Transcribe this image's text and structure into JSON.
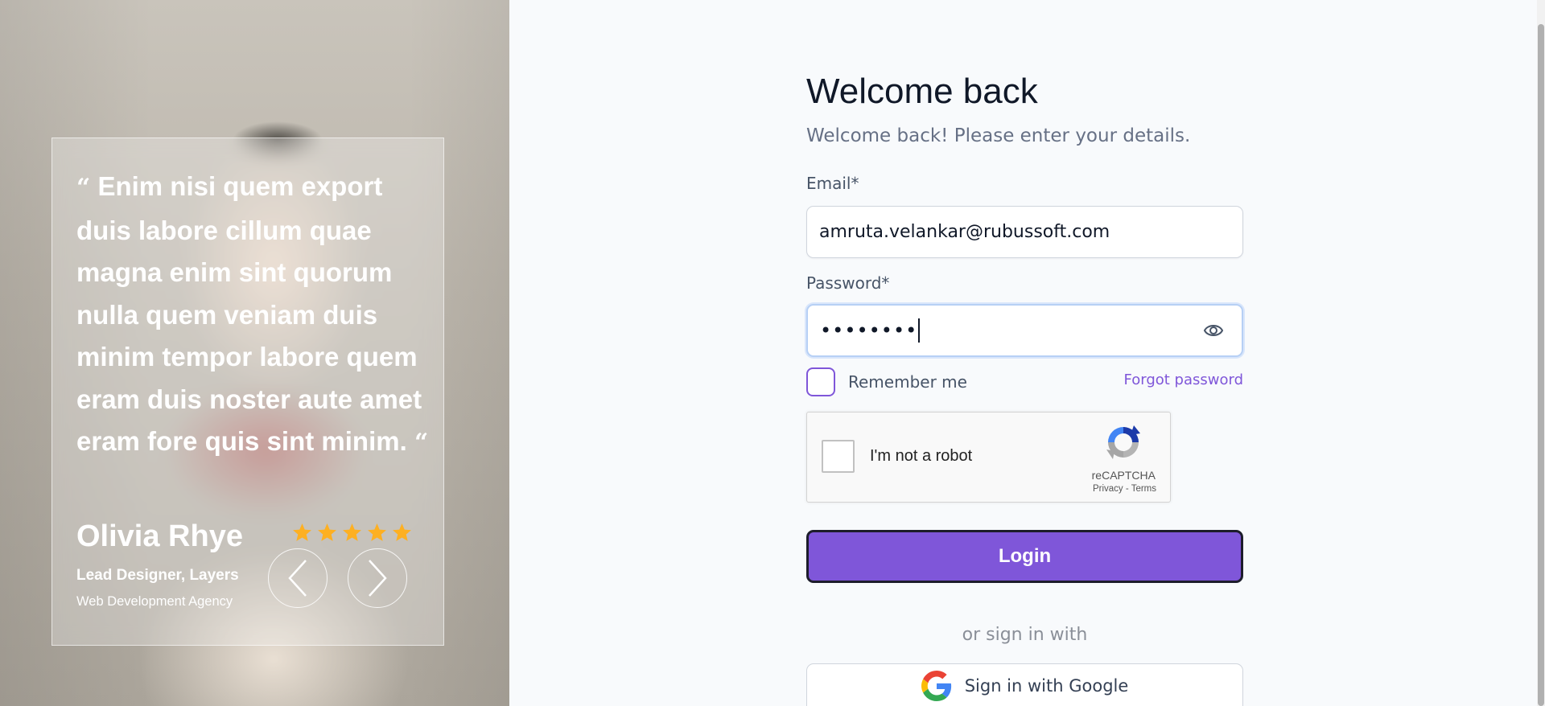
{
  "testimonial": {
    "quote": "Enim nisi quem export duis labore cillum quae magna enim sint quorum nulla quem veniam duis minim tempor labore quem eram duis noster aute amet eram fore quis sint minim.",
    "open_mark": "“",
    "close_mark": "“",
    "author": "Olivia Rhye",
    "role": "Lead Designer, Layers",
    "organization": "Web Development Agency",
    "rating": 5,
    "rating_max": 5,
    "star_color": "#fdb022",
    "prev_icon": "chevron-left-icon",
    "next_icon": "chevron-right-icon"
  },
  "login": {
    "title": "Welcome back",
    "subtitle": "Welcome back! Please enter your details.",
    "email_label": "Email*",
    "email_value": "amruta.velankar@rubussoft.com",
    "password_label": "Password*",
    "password_value_masked": "••••••••",
    "show_password_icon": "eye-icon",
    "remember_label": "Remember me",
    "remember_checked": false,
    "forgot_label": "Forgot password",
    "login_label": "Login",
    "divider_text": "or sign in with",
    "google_label": "Sign in with Google",
    "accent_color": "#7f56d9"
  },
  "recaptcha": {
    "label": "I'm not a robot",
    "brand": "reCAPTCHA",
    "privacy": "Privacy",
    "separator": " - ",
    "terms": "Terms",
    "checked": false
  }
}
